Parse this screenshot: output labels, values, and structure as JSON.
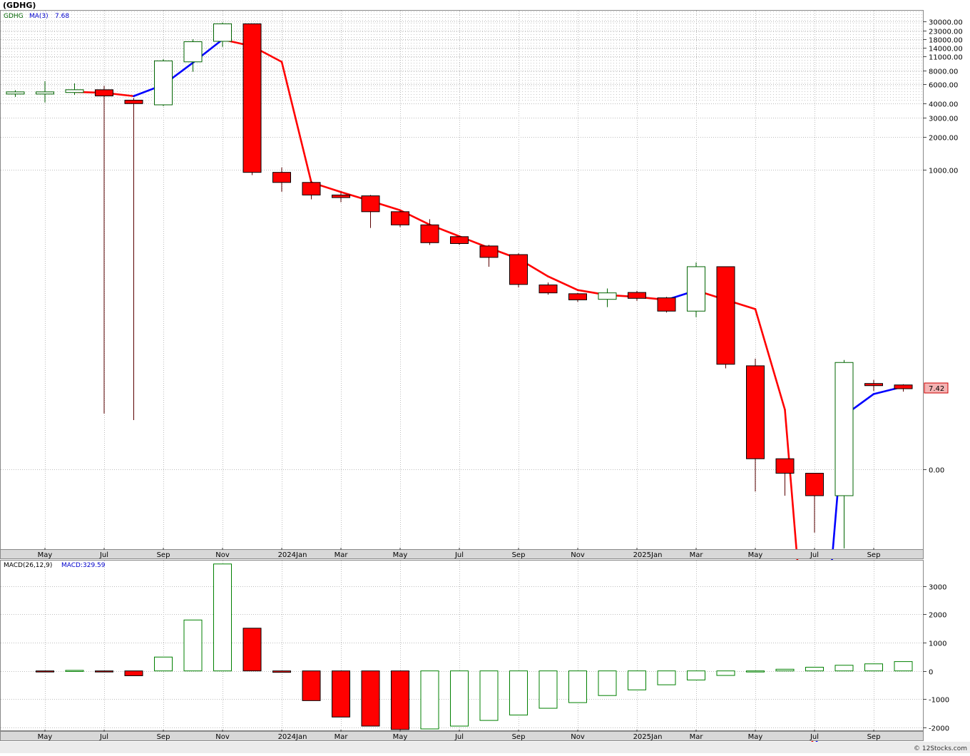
{
  "header": {
    "ticker_title": "(GDHG)"
  },
  "price_legend": {
    "symbol": "GDHG",
    "ma_label": "MA(3)",
    "ma_value": "7.68"
  },
  "macd_legend": {
    "label": "MACD(26,12,9)",
    "value_label": "MACD:329.59"
  },
  "last_price_tag": "7.42",
  "footer": {
    "credit": "© 12Stocks.com"
  },
  "colors": {
    "up": "#006400",
    "down": "#ff0000",
    "ma_rising": "#0000ff",
    "ma_falling": "#ff0000",
    "macd_up": "#008000",
    "macd_down": "#ff0000",
    "tag_bg": "#f4b3b3",
    "tag_border": "#cc0000",
    "grid": "#bdbdbd"
  },
  "chart_data": [
    {
      "type": "candlestick",
      "title": "(GDHG)",
      "scale": "log-hybrid",
      "x_ticks": [
        "May",
        "Jul",
        "Sep",
        "Nov",
        "2024Jan",
        "Mar",
        "May",
        "Jul",
        "Sep",
        "Nov",
        "2025Jan",
        "Mar",
        "May",
        "Jul",
        "Sep"
      ],
      "y_ticks": [
        "30000.00",
        "23000.00",
        "18000.00",
        "14000.00",
        "11000.00",
        "8000.00",
        "6000.00",
        "4000.00",
        "3000.00",
        "2000.00",
        "1000.00",
        "0.00"
      ],
      "months": [
        "2023-04",
        "2023-05",
        "2023-06",
        "2023-07",
        "2023-08",
        "2023-09",
        "2023-10",
        "2023-11",
        "2023-12",
        "2024-01",
        "2024-02",
        "2024-03",
        "2024-04",
        "2024-05",
        "2024-06",
        "2024-07",
        "2024-08",
        "2024-09",
        "2024-10",
        "2024-11",
        "2024-12",
        "2025-01",
        "2025-02",
        "2025-03",
        "2025-04",
        "2025-05",
        "2025-06",
        "2025-07",
        "2025-08",
        "2025-09",
        "2025-10"
      ],
      "candles": [
        {
          "o": 5000,
          "h": 5300,
          "l": 4600,
          "c": 5000
        },
        {
          "o": 5000,
          "h": 6400,
          "l": 4100,
          "c": 5000
        },
        {
          "o": 5050,
          "h": 6100,
          "l": 4800,
          "c": 5350
        },
        {
          "o": 5350,
          "h": 5800,
          "l": 4.0,
          "c": 4700
        },
        {
          "o": 4300,
          "h": 4500,
          "l": 3.4,
          "c": 4000
        },
        {
          "o": 3900,
          "h": 10200,
          "l": 3800,
          "c": 9800
        },
        {
          "o": 9600,
          "h": 18000,
          "l": 7800,
          "c": 16800
        },
        {
          "o": 17000,
          "h": 29000,
          "l": 14500,
          "c": 28000
        },
        {
          "o": 28000,
          "h": 28000,
          "l": 900,
          "c": 950
        },
        {
          "o": 950,
          "h": 1050,
          "l": 650,
          "c": 780
        },
        {
          "o": 780,
          "h": 800,
          "l": 560,
          "c": 610
        },
        {
          "o": 610,
          "h": 640,
          "l": 530,
          "c": 580
        },
        {
          "o": 600,
          "h": 610,
          "l": 320,
          "c": 440
        },
        {
          "o": 440,
          "h": 450,
          "l": 325,
          "c": 340
        },
        {
          "o": 340,
          "h": 380,
          "l": 230,
          "c": 240
        },
        {
          "o": 270,
          "h": 275,
          "l": 230,
          "c": 236
        },
        {
          "o": 225,
          "h": 230,
          "l": 150,
          "c": 180
        },
        {
          "o": 190,
          "h": 195,
          "l": 100,
          "c": 106
        },
        {
          "o": 105,
          "h": 110,
          "l": 82,
          "c": 86
        },
        {
          "o": 84,
          "h": 86,
          "l": 67,
          "c": 71
        },
        {
          "o": 72,
          "h": 97,
          "l": 58,
          "c": 86
        },
        {
          "o": 87,
          "h": 91,
          "l": 69,
          "c": 74
        },
        {
          "o": 75,
          "h": 77,
          "l": 50,
          "c": 52
        },
        {
          "o": 52,
          "h": 163,
          "l": 44,
          "c": 150
        },
        {
          "o": 150,
          "h": 150,
          "l": 10.7,
          "c": 12
        },
        {
          "o": 11.5,
          "h": 14,
          "l": 0.8,
          "c": 1.3
        },
        {
          "o": 1.3,
          "h": 1.3,
          "l": -1.0,
          "c": -0.15
        },
        {
          "o": -0.15,
          "h": 0.9,
          "l": -2.4,
          "c": -1.0
        },
        {
          "o": -1.0,
          "h": 13.5,
          "l": -3.0,
          "c": 12.6
        },
        {
          "o": 8.0,
          "h": 8.6,
          "l": 7.0,
          "c": 7.9
        },
        {
          "o": 7.9,
          "h": 8.0,
          "l": 6.9,
          "c": 7.42
        }
      ],
      "ma3": [
        null,
        null,
        5117,
        5017,
        4683,
        5933,
        9433,
        17900,
        14800,
        9600,
        780,
        647,
        543,
        453,
        341,
        272,
        217,
        175,
        124,
        93,
        81,
        77,
        71,
        92,
        71,
        55,
        4.4,
        0.05,
        3.8,
        6.5,
        7.68
      ]
    },
    {
      "type": "bar",
      "title": "MACD(26,12,9)",
      "y_ticks": [
        3000,
        2000,
        1000,
        0,
        -1000,
        -2000
      ],
      "ylim": [
        -2100,
        3900
      ],
      "values": [
        null,
        -10,
        20,
        -20,
        -170,
        490,
        1800,
        3780,
        1510,
        -50,
        -1050,
        -1630,
        -1950,
        -2070,
        -2050,
        -1950,
        -1750,
        -1560,
        -1320,
        -1120,
        -870,
        -670,
        -490,
        -320,
        -160,
        -30,
        60,
        130,
        200,
        250,
        330
      ]
    }
  ]
}
